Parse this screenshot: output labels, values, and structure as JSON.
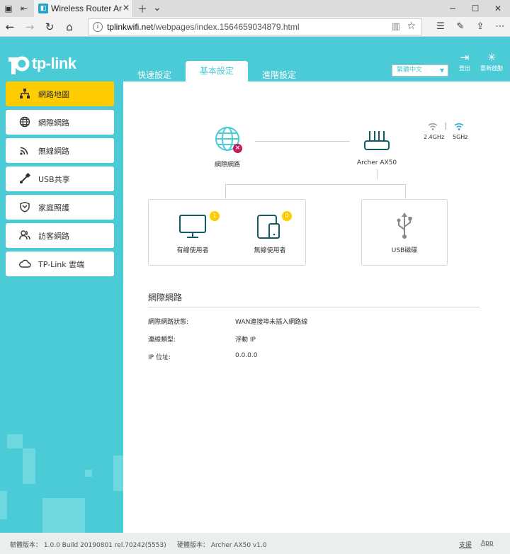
{
  "browser": {
    "tab_title": "Wireless Router Archer ...",
    "url_domain": "tplinkwifi.net",
    "url_path": "/webpages/index.1564659034879.html"
  },
  "brand": {
    "logo_text": "tp-link",
    "accent_color": "#4acbd6",
    "highlight_color": "#fecc00"
  },
  "header": {
    "tabs": [
      {
        "label": "快速設定",
        "active": false
      },
      {
        "label": "基本設定",
        "active": true
      },
      {
        "label": "進階設定",
        "active": false
      }
    ],
    "language": "繁體中文",
    "logout_label": "登出",
    "reboot_label": "重新啟動"
  },
  "sidebar": {
    "items": [
      {
        "label": "網路地圖",
        "icon": "network-map-icon",
        "active": true
      },
      {
        "label": "網際網路",
        "icon": "globe-icon",
        "active": false
      },
      {
        "label": "無線網路",
        "icon": "wireless-icon",
        "active": false
      },
      {
        "label": "USB共享",
        "icon": "usb-icon",
        "active": false
      },
      {
        "label": "家庭照護",
        "icon": "shield-icon",
        "active": false
      },
      {
        "label": "訪客網路",
        "icon": "guests-icon",
        "active": false
      },
      {
        "label": "TP-Link 雲端",
        "icon": "cloud-icon",
        "active": false
      }
    ]
  },
  "map": {
    "internet_label": "網際網路",
    "router_label": "Archer AX50",
    "band_24_label": "2.4GHz",
    "band_5_label": "5GHz",
    "wired_label": "有線使用者",
    "wired_count": "1",
    "wireless_label": "無線使用者",
    "wireless_count": "0",
    "usb_label": "USB磁碟"
  },
  "internet_info": {
    "title": "網際網路",
    "rows": [
      {
        "label": "網際網路狀態:",
        "value": "WAN連接埠未插入網路線"
      },
      {
        "label": "連線類型:",
        "value": "浮動 IP"
      },
      {
        "label": "IP 位址:",
        "value": "0.0.0.0"
      }
    ]
  },
  "footer": {
    "firmware_label": "韌體版本：",
    "firmware_value": "1.0.0 Build 20190801 rel.70242(5553)",
    "hardware_label": "硬體版本：",
    "hardware_value": "Archer AX50 v1.0",
    "support_link": "支援",
    "app_link": "App"
  }
}
